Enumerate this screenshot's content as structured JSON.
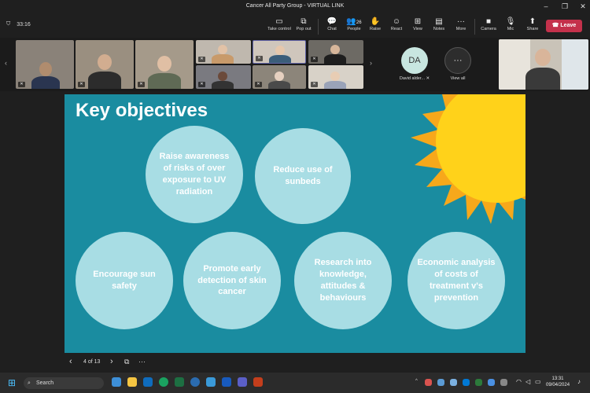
{
  "window": {
    "title": "Cancer All Party Group - VIRTUAL LINK",
    "minimize": "–",
    "restore": "❐",
    "close": "✕"
  },
  "meeting": {
    "timer": "33:16",
    "toolbar": [
      {
        "label": "Take control",
        "icon": "take-control-icon",
        "glyph": "▭"
      },
      {
        "label": "Pop out",
        "icon": "pop-out-icon",
        "glyph": "⧉"
      },
      {
        "label": "Chat",
        "icon": "chat-icon",
        "glyph": "💬"
      },
      {
        "label": "People",
        "icon": "people-icon",
        "glyph": "👥",
        "badge": "26"
      },
      {
        "label": "Raise",
        "icon": "raise-hand-icon",
        "glyph": "✋"
      },
      {
        "label": "React",
        "icon": "react-icon",
        "glyph": "☺"
      },
      {
        "label": "View",
        "icon": "view-icon",
        "glyph": "⊞"
      },
      {
        "label": "Notes",
        "icon": "notes-icon",
        "glyph": "▤"
      },
      {
        "label": "More",
        "icon": "more-icon",
        "glyph": "···"
      },
      {
        "label": "Camera",
        "icon": "camera-icon",
        "glyph": "■"
      },
      {
        "label": "Mic",
        "icon": "mic-icon",
        "glyph": "🎙"
      },
      {
        "label": "Share",
        "icon": "share-icon",
        "glyph": "⬆"
      }
    ],
    "leave": "Leave"
  },
  "participants": {
    "david": {
      "initials": "DA",
      "name": "David alder..."
    },
    "view_all": {
      "glyph": "···",
      "label": "View all"
    }
  },
  "slide": {
    "heading": "Key objectives",
    "objectives": [
      "Raise awareness of risks of over exposure to UV radiation",
      "Reduce use of sunbeds",
      "Encourage sun safety",
      "Promote early detection of skin cancer",
      "Research into knowledge, attitudes & behaviours",
      "Economic analysis of costs of treatment v's prevention"
    ],
    "colors": {
      "background": "#1a8ca0",
      "bubble": "#a8dde4",
      "sun": "#ffd21a"
    }
  },
  "slide_nav": {
    "prev": "‹",
    "page": "4 of 13",
    "next": "›",
    "more": "···"
  },
  "taskbar": {
    "search_placeholder": "Search",
    "time": "13:31",
    "date": "09/04/2024"
  }
}
